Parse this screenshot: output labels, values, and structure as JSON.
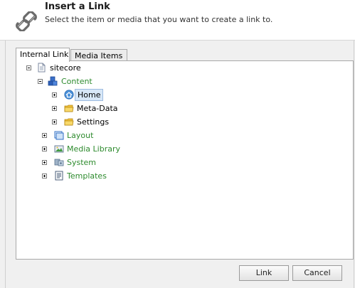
{
  "dialog": {
    "title": "Insert a Link",
    "subtitle": "Select the item or media that you want to create a link to."
  },
  "tabs": [
    {
      "label": "Internal Link",
      "active": true
    },
    {
      "label": "Media Items",
      "active": false
    }
  ],
  "tree": {
    "root": {
      "label": "sitecore",
      "expanded": true
    },
    "content": {
      "label": "Content",
      "expanded": true
    },
    "home": {
      "label": "Home",
      "selected": true
    },
    "meta_data": {
      "label": "Meta-Data"
    },
    "settings": {
      "label": "Settings"
    },
    "layout": {
      "label": "Layout"
    },
    "media_library": {
      "label": "Media Library"
    },
    "system": {
      "label": "System"
    },
    "templates": {
      "label": "Templates"
    }
  },
  "buttons": {
    "link": "Link",
    "cancel": "Cancel"
  },
  "colors": {
    "tree_green": "#2e8b2e",
    "selection_bg": "#d7e7f7",
    "body_bg": "#f0f0f0"
  }
}
